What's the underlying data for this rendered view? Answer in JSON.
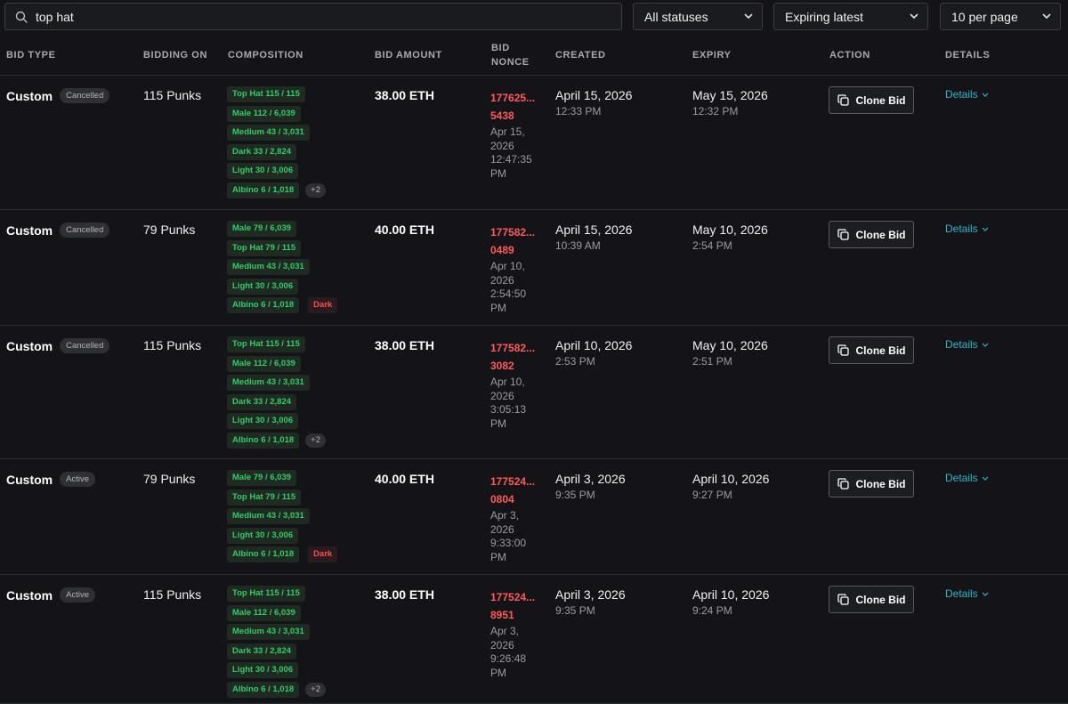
{
  "search": {
    "value": "top hat",
    "icon": "search-icon"
  },
  "filters": {
    "status": "All statuses",
    "sort": "Expiring latest",
    "page_size": "10 per page"
  },
  "columns": [
    "BID TYPE",
    "BIDDING ON",
    "COMPOSITION",
    "BID AMOUNT",
    "BID",
    "NONCE",
    "CREATED",
    "EXPIRY",
    "ACTION",
    "DETAILS"
  ],
  "rows": [
    {
      "type": "Custom",
      "status": "Cancelled",
      "bidding_on": "115 Punks",
      "composition": [
        "Top Hat 115 / 115",
        "Male 112 / 6,039",
        "Medium 43 / 3,031",
        "Dark 33 / 2,824",
        "Light 30 / 3,006",
        "Albino 6 / 1,018"
      ],
      "more": "+2",
      "exclude": "",
      "amount": "38.00 ETH",
      "nonce_a": "177625...",
      "nonce_b": "5438",
      "nonce_date": [
        "Apr 15,",
        "2026",
        "12:47:35",
        "PM"
      ],
      "created_date": "April 15, 2026",
      "created_time": "12:33 PM",
      "expiry_date": "May 15, 2026",
      "expiry_time": "12:32 PM",
      "action": "Clone Bid",
      "details": "Details"
    },
    {
      "type": "Custom",
      "status": "Cancelled",
      "bidding_on": "79 Punks",
      "composition": [
        "Male 79 / 6,039",
        "Top Hat 79 / 115",
        "Medium 43 / 3,031",
        "Light 30 / 3,006",
        "Albino 6 / 1,018"
      ],
      "more": "",
      "exclude": "Dark",
      "amount": "40.00 ETH",
      "nonce_a": "177582...",
      "nonce_b": "0489",
      "nonce_date": [
        "Apr 10,",
        "2026",
        "2:54:50",
        "PM"
      ],
      "created_date": "April 15, 2026",
      "created_time": "10:39 AM",
      "expiry_date": "May 10, 2026",
      "expiry_time": "2:54 PM",
      "action": "Clone Bid",
      "details": "Details"
    },
    {
      "type": "Custom",
      "status": "Cancelled",
      "bidding_on": "115 Punks",
      "composition": [
        "Top Hat 115 / 115",
        "Male 112 / 6,039",
        "Medium 43 / 3,031",
        "Dark 33 / 2,824",
        "Light 30 / 3,006",
        "Albino 6 / 1,018"
      ],
      "more": "+2",
      "exclude": "",
      "amount": "38.00 ETH",
      "nonce_a": "177582...",
      "nonce_b": "3082",
      "nonce_date": [
        "Apr 10,",
        "2026",
        "3:05:13",
        "PM"
      ],
      "created_date": "April 10, 2026",
      "created_time": "2:53 PM",
      "expiry_date": "May 10, 2026",
      "expiry_time": "2:51 PM",
      "action": "Clone Bid",
      "details": "Details"
    },
    {
      "type": "Custom",
      "status": "Active",
      "bidding_on": "79 Punks",
      "composition": [
        "Male 79 / 6,039",
        "Top Hat 79 / 115",
        "Medium 43 / 3,031",
        "Light 30 / 3,006",
        "Albino 6 / 1,018"
      ],
      "more": "",
      "exclude": "Dark",
      "amount": "40.00 ETH",
      "nonce_a": "177524...",
      "nonce_b": "0804",
      "nonce_date": [
        "Apr 3,",
        "2026",
        "9:33:00",
        "PM"
      ],
      "created_date": "April 3, 2026",
      "created_time": "9:35 PM",
      "expiry_date": "April 10, 2026",
      "expiry_time": "9:27 PM",
      "action": "Clone Bid",
      "details": "Details"
    },
    {
      "type": "Custom",
      "status": "Active",
      "bidding_on": "115 Punks",
      "composition": [
        "Top Hat 115 / 115",
        "Male 112 / 6,039",
        "Medium 43 / 3,031",
        "Dark 33 / 2,824",
        "Light 30 / 3,006",
        "Albino 6 / 1,018"
      ],
      "more": "+2",
      "exclude": "",
      "amount": "38.00 ETH",
      "nonce_a": "177524...",
      "nonce_b": "8951",
      "nonce_date": [
        "Apr 3,",
        "2026",
        "9:26:48",
        "PM"
      ],
      "created_date": "April 3, 2026",
      "created_time": "9:35 PM",
      "expiry_date": "April 10, 2026",
      "expiry_time": "9:24 PM",
      "action": "Clone Bid",
      "details": "Details"
    }
  ],
  "colors": {
    "background": "#141418",
    "chip_text": "#33cc66",
    "nonce": "#ff5a5a",
    "link": "#2eb5c8",
    "exclude": "#ff4d4d"
  }
}
